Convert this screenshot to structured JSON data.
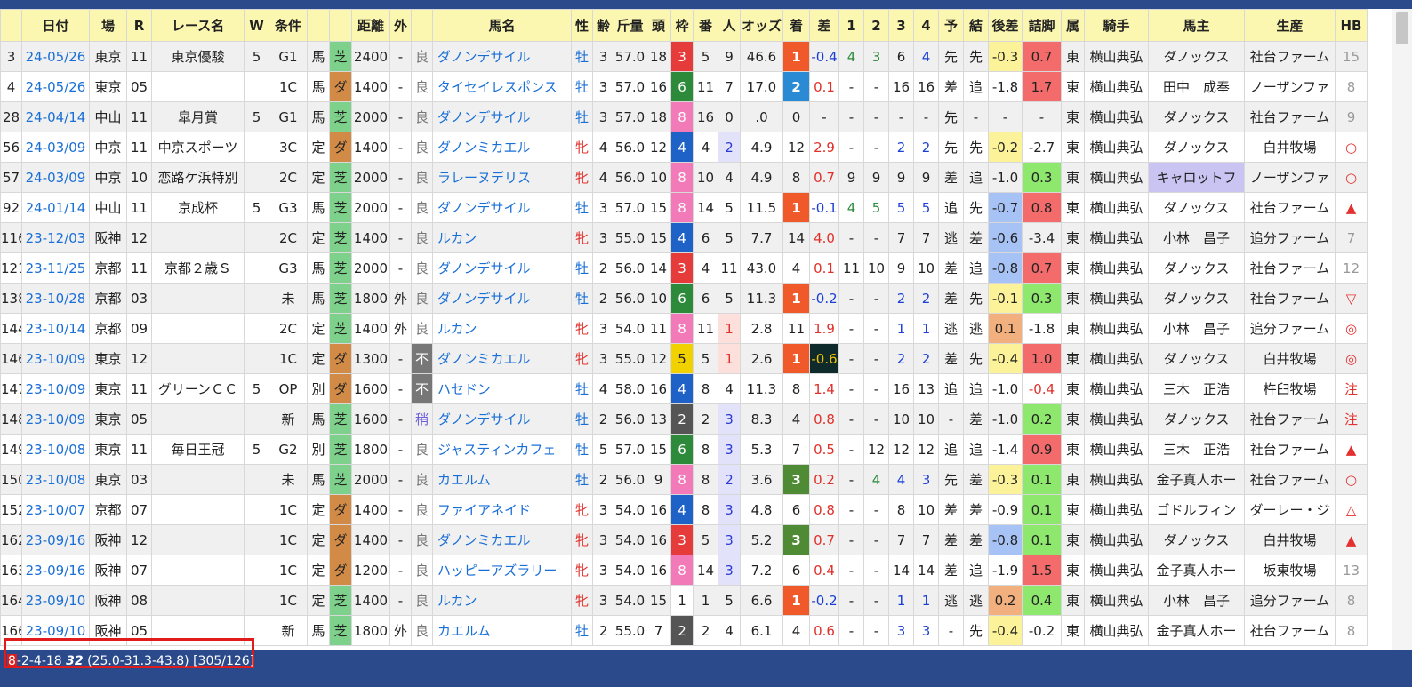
{
  "colors": {
    "accent": "#2b4a8c",
    "link": "#1a6fd6",
    "female": "#e0302a",
    "turf": "#7ed18a",
    "dirt": "#d28b46",
    "header_bg": "#fbf7b0",
    "highlight": "#e01b1b"
  },
  "headers": [
    "",
    "日付",
    "場",
    "R",
    "レース名",
    "W",
    "条件",
    "",
    "",
    "距離",
    "外",
    "",
    "馬名",
    "性",
    "齢",
    "斤量",
    "頭",
    "枠",
    "番",
    "人",
    "オッズ",
    "着",
    "差",
    "1",
    "2",
    "3",
    "4",
    "予",
    "結",
    "後差",
    "詰脚",
    "属",
    "騎手",
    "馬主",
    "生産",
    "HB"
  ],
  "rows": [
    {
      "no": "3",
      "date": "24-05/26",
      "venue": "東京",
      "r": "11",
      "race": "東京優駿",
      "w": "5",
      "grade": "G1",
      "cond": "馬",
      "surf": "芝",
      "dist": "2400",
      "out": "-",
      "track": "良",
      "horse": "ダノンデサイル",
      "sex": "牡",
      "age": "3",
      "kg": "57.0",
      "heads": "18",
      "waku": "3",
      "ban": "5",
      "pop": "9",
      "odds": "46.6",
      "chaku": "1",
      "sa": "-0.4",
      "c1": "4",
      "c2": "3",
      "c3": "6",
      "c4": "4",
      "yo": "先",
      "ke": "先",
      "atosa": "-0.3",
      "tsume": "0.7",
      "zoku": "東",
      "jockey": "横山典弘",
      "owner": "ダノックス",
      "breeder": "社台ファーム",
      "hb": "15"
    },
    {
      "no": "4",
      "date": "24-05/26",
      "venue": "東京",
      "r": "05",
      "race": "",
      "w": "",
      "grade": "1C",
      "cond": "馬",
      "surf": "ダ",
      "dist": "1400",
      "out": "-",
      "track": "良",
      "horse": "タイセイレスポンス",
      "sex": "牡",
      "age": "3",
      "kg": "57.0",
      "heads": "16",
      "waku": "6",
      "ban": "11",
      "pop": "7",
      "odds": "17.0",
      "chaku": "2",
      "sa": "0.1",
      "c1": "-",
      "c2": "-",
      "c3": "16",
      "c4": "16",
      "yo": "差",
      "ke": "追",
      "atosa": "-1.8",
      "tsume": "1.7",
      "zoku": "東",
      "jockey": "横山典弘",
      "owner": "田中　成奉",
      "breeder": "ノーザンファ",
      "hb": "8"
    },
    {
      "no": "28",
      "date": "24-04/14",
      "venue": "中山",
      "r": "11",
      "race": "皐月賞",
      "w": "5",
      "grade": "G1",
      "cond": "馬",
      "surf": "芝",
      "dist": "2000",
      "out": "-",
      "track": "良",
      "horse": "ダノンデサイル",
      "sex": "牡",
      "age": "3",
      "kg": "57.0",
      "heads": "18",
      "waku": "8",
      "ban": "16",
      "pop": "0",
      "odds": ".0",
      "chaku": "0",
      "sa": "-",
      "c1": "-",
      "c2": "-",
      "c3": "-",
      "c4": "-",
      "yo": "先",
      "ke": "-",
      "atosa": "-",
      "tsume": "-",
      "zoku": "東",
      "jockey": "横山典弘",
      "owner": "ダノックス",
      "breeder": "社台ファーム",
      "hb": "9"
    },
    {
      "no": "56",
      "date": "24-03/09",
      "venue": "中京",
      "r": "11",
      "race": "中京スポーツ",
      "w": "",
      "grade": "3C",
      "cond": "定",
      "surf": "ダ",
      "dist": "1400",
      "out": "-",
      "track": "良",
      "horse": "ダノンミカエル",
      "sex": "牝",
      "age": "4",
      "kg": "56.0",
      "heads": "12",
      "waku": "4",
      "ban": "4",
      "pop": "2",
      "odds": "4.9",
      "chaku": "12",
      "sa": "2.9",
      "c1": "-",
      "c2": "-",
      "c3": "2",
      "c4": "2",
      "yo": "先",
      "ke": "先",
      "atosa": "-0.2",
      "tsume": "-2.7",
      "zoku": "東",
      "jockey": "横山典弘",
      "owner": "ダノックス",
      "breeder": "白井牧場",
      "hb": "○"
    },
    {
      "no": "57",
      "date": "24-03/09",
      "venue": "中京",
      "r": "10",
      "race": "恋路ケ浜特別",
      "w": "",
      "grade": "2C",
      "cond": "定",
      "surf": "芝",
      "dist": "2000",
      "out": "-",
      "track": "良",
      "horse": "ラレーヌデリス",
      "sex": "牝",
      "age": "4",
      "kg": "56.0",
      "heads": "10",
      "waku": "8",
      "ban": "10",
      "pop": "4",
      "odds": "4.9",
      "chaku": "8",
      "sa": "0.7",
      "c1": "9",
      "c2": "9",
      "c3": "9",
      "c4": "9",
      "yo": "差",
      "ke": "追",
      "atosa": "-1.0",
      "tsume": "0.3",
      "zoku": "東",
      "jockey": "横山典弘",
      "owner": "キャロットフ",
      "breeder": "ノーザンファ",
      "hb": "○"
    },
    {
      "no": "92",
      "date": "24-01/14",
      "venue": "中山",
      "r": "11",
      "race": "京成杯",
      "w": "5",
      "grade": "G3",
      "cond": "馬",
      "surf": "芝",
      "dist": "2000",
      "out": "-",
      "track": "良",
      "horse": "ダノンデサイル",
      "sex": "牡",
      "age": "3",
      "kg": "57.0",
      "heads": "15",
      "waku": "8",
      "ban": "14",
      "pop": "5",
      "odds": "11.5",
      "chaku": "1",
      "sa": "-0.1",
      "c1": "4",
      "c2": "5",
      "c3": "5",
      "c4": "5",
      "yo": "追",
      "ke": "先",
      "atosa": "-0.7",
      "tsume": "0.8",
      "zoku": "東",
      "jockey": "横山典弘",
      "owner": "ダノックス",
      "breeder": "社台ファーム",
      "hb": "▲"
    },
    {
      "no": "116",
      "date": "23-12/03",
      "venue": "阪神",
      "r": "12",
      "race": "",
      "w": "",
      "grade": "2C",
      "cond": "定",
      "surf": "芝",
      "dist": "1400",
      "out": "-",
      "track": "良",
      "horse": "ルカン",
      "sex": "牝",
      "age": "3",
      "kg": "55.0",
      "heads": "15",
      "waku": "4",
      "ban": "6",
      "pop": "5",
      "odds": "7.7",
      "chaku": "14",
      "sa": "4.0",
      "c1": "-",
      "c2": "-",
      "c3": "7",
      "c4": "7",
      "yo": "逃",
      "ke": "差",
      "atosa": "-0.6",
      "tsume": "-3.4",
      "zoku": "東",
      "jockey": "横山典弘",
      "owner": "小林　昌子",
      "breeder": "追分ファーム",
      "hb": "7"
    },
    {
      "no": "121",
      "date": "23-11/25",
      "venue": "京都",
      "r": "11",
      "race": "京都２歳Ｓ",
      "w": "",
      "grade": "G3",
      "cond": "馬",
      "surf": "芝",
      "dist": "2000",
      "out": "-",
      "track": "良",
      "horse": "ダノンデサイル",
      "sex": "牡",
      "age": "2",
      "kg": "56.0",
      "heads": "14",
      "waku": "3",
      "ban": "4",
      "pop": "11",
      "odds": "43.0",
      "chaku": "4",
      "sa": "0.1",
      "c1": "11",
      "c2": "10",
      "c3": "9",
      "c4": "10",
      "yo": "差",
      "ke": "追",
      "atosa": "-0.8",
      "tsume": "0.7",
      "zoku": "東",
      "jockey": "横山典弘",
      "owner": "ダノックス",
      "breeder": "社台ファーム",
      "hb": "12"
    },
    {
      "no": "138",
      "date": "23-10/28",
      "venue": "京都",
      "r": "03",
      "race": "",
      "w": "",
      "grade": "未",
      "cond": "馬",
      "surf": "芝",
      "dist": "1800",
      "out": "外",
      "track": "良",
      "horse": "ダノンデサイル",
      "sex": "牡",
      "age": "2",
      "kg": "56.0",
      "heads": "10",
      "waku": "6",
      "ban": "6",
      "pop": "5",
      "odds": "11.3",
      "chaku": "1",
      "sa": "-0.2",
      "c1": "-",
      "c2": "-",
      "c3": "2",
      "c4": "2",
      "yo": "差",
      "ke": "先",
      "atosa": "-0.1",
      "tsume": "0.3",
      "zoku": "東",
      "jockey": "横山典弘",
      "owner": "ダノックス",
      "breeder": "社台ファーム",
      "hb": "▽"
    },
    {
      "no": "144",
      "date": "23-10/14",
      "venue": "京都",
      "r": "09",
      "race": "",
      "w": "",
      "grade": "2C",
      "cond": "定",
      "surf": "芝",
      "dist": "1400",
      "out": "外",
      "track": "良",
      "horse": "ルカン",
      "sex": "牝",
      "age": "3",
      "kg": "54.0",
      "heads": "11",
      "waku": "8",
      "ban": "11",
      "pop": "1",
      "odds": "2.8",
      "chaku": "11",
      "sa": "1.9",
      "c1": "-",
      "c2": "-",
      "c3": "1",
      "c4": "1",
      "yo": "逃",
      "ke": "逃",
      "atosa": "0.1",
      "tsume": "-1.8",
      "zoku": "東",
      "jockey": "横山典弘",
      "owner": "小林　昌子",
      "breeder": "追分ファーム",
      "hb": "◎"
    },
    {
      "no": "146",
      "date": "23-10/09",
      "venue": "東京",
      "r": "12",
      "race": "",
      "w": "",
      "grade": "1C",
      "cond": "定",
      "surf": "ダ",
      "dist": "1300",
      "out": "-",
      "track": "不",
      "horse": "ダノンミカエル",
      "sex": "牝",
      "age": "3",
      "kg": "55.0",
      "heads": "12",
      "waku": "5",
      "ban": "5",
      "pop": "1",
      "odds": "2.6",
      "chaku": "1",
      "sa": "-0.6",
      "c1": "-",
      "c2": "-",
      "c3": "2",
      "c4": "2",
      "yo": "差",
      "ke": "先",
      "atosa": "-0.4",
      "tsume": "1.0",
      "zoku": "東",
      "jockey": "横山典弘",
      "owner": "ダノックス",
      "breeder": "白井牧場",
      "hb": "◎"
    },
    {
      "no": "147",
      "date": "23-10/09",
      "venue": "東京",
      "r": "11",
      "race": "グリーンＣＣ",
      "w": "5",
      "grade": "OP",
      "cond": "別",
      "surf": "ダ",
      "dist": "1600",
      "out": "-",
      "track": "不",
      "horse": "ハセドン",
      "sex": "牡",
      "age": "4",
      "kg": "58.0",
      "heads": "16",
      "waku": "4",
      "ban": "8",
      "pop": "4",
      "odds": "11.3",
      "chaku": "8",
      "sa": "1.4",
      "c1": "-",
      "c2": "-",
      "c3": "16",
      "c4": "13",
      "yo": "追",
      "ke": "追",
      "atosa": "-1.0",
      "tsume": "-0.4",
      "zoku": "東",
      "jockey": "横山典弘",
      "owner": "三木　正浩",
      "breeder": "杵臼牧場",
      "hb": "注"
    },
    {
      "no": "148",
      "date": "23-10/09",
      "venue": "東京",
      "r": "05",
      "race": "",
      "w": "",
      "grade": "新",
      "cond": "馬",
      "surf": "芝",
      "dist": "1600",
      "out": "-",
      "track": "稍",
      "horse": "ダノンデサイル",
      "sex": "牡",
      "age": "2",
      "kg": "56.0",
      "heads": "13",
      "waku": "2",
      "ban": "2",
      "pop": "3",
      "odds": "8.3",
      "chaku": "4",
      "sa": "0.8",
      "c1": "-",
      "c2": "-",
      "c3": "10",
      "c4": "10",
      "yo": "-",
      "ke": "差",
      "atosa": "-1.0",
      "tsume": "0.2",
      "zoku": "東",
      "jockey": "横山典弘",
      "owner": "ダノックス",
      "breeder": "社台ファーム",
      "hb": "注"
    },
    {
      "no": "149",
      "date": "23-10/08",
      "venue": "東京",
      "r": "11",
      "race": "毎日王冠",
      "w": "5",
      "grade": "G2",
      "cond": "別",
      "surf": "芝",
      "dist": "1800",
      "out": "-",
      "track": "良",
      "horse": "ジャスティンカフェ",
      "sex": "牡",
      "age": "5",
      "kg": "57.0",
      "heads": "15",
      "waku": "6",
      "ban": "8",
      "pop": "3",
      "odds": "5.3",
      "chaku": "7",
      "sa": "0.5",
      "c1": "-",
      "c2": "12",
      "c3": "12",
      "c4": "12",
      "yo": "追",
      "ke": "追",
      "atosa": "-1.4",
      "tsume": "0.9",
      "zoku": "東",
      "jockey": "横山典弘",
      "owner": "三木　正浩",
      "breeder": "社台ファーム",
      "hb": "▲"
    },
    {
      "no": "150",
      "date": "23-10/08",
      "venue": "東京",
      "r": "03",
      "race": "",
      "w": "",
      "grade": "未",
      "cond": "馬",
      "surf": "芝",
      "dist": "2000",
      "out": "-",
      "track": "良",
      "horse": "カエルム",
      "sex": "牡",
      "age": "2",
      "kg": "56.0",
      "heads": "9",
      "waku": "8",
      "ban": "8",
      "pop": "2",
      "odds": "3.6",
      "chaku": "3",
      "sa": "0.2",
      "c1": "-",
      "c2": "4",
      "c3": "4",
      "c4": "3",
      "yo": "先",
      "ke": "差",
      "atosa": "-0.3",
      "tsume": "0.1",
      "zoku": "東",
      "jockey": "横山典弘",
      "owner": "金子真人ホー",
      "breeder": "社台ファーム",
      "hb": "○"
    },
    {
      "no": "152",
      "date": "23-10/07",
      "venue": "京都",
      "r": "07",
      "race": "",
      "w": "",
      "grade": "1C",
      "cond": "定",
      "surf": "ダ",
      "dist": "1400",
      "out": "-",
      "track": "良",
      "horse": "ファイアネイド",
      "sex": "牝",
      "age": "3",
      "kg": "54.0",
      "heads": "16",
      "waku": "4",
      "ban": "8",
      "pop": "3",
      "odds": "4.8",
      "chaku": "6",
      "sa": "0.8",
      "c1": "-",
      "c2": "-",
      "c3": "8",
      "c4": "10",
      "yo": "差",
      "ke": "差",
      "atosa": "-0.9",
      "tsume": "0.1",
      "zoku": "東",
      "jockey": "横山典弘",
      "owner": "ゴドルフィン",
      "breeder": "ダーレー・ジ",
      "hb": "△"
    },
    {
      "no": "162",
      "date": "23-09/16",
      "venue": "阪神",
      "r": "12",
      "race": "",
      "w": "",
      "grade": "1C",
      "cond": "定",
      "surf": "ダ",
      "dist": "1400",
      "out": "-",
      "track": "良",
      "horse": "ダノンミカエル",
      "sex": "牝",
      "age": "3",
      "kg": "54.0",
      "heads": "16",
      "waku": "3",
      "ban": "5",
      "pop": "3",
      "odds": "5.2",
      "chaku": "3",
      "sa": "0.7",
      "c1": "-",
      "c2": "-",
      "c3": "7",
      "c4": "7",
      "yo": "差",
      "ke": "差",
      "atosa": "-0.8",
      "tsume": "0.1",
      "zoku": "東",
      "jockey": "横山典弘",
      "owner": "ダノックス",
      "breeder": "白井牧場",
      "hb": "▲"
    },
    {
      "no": "163",
      "date": "23-09/16",
      "venue": "阪神",
      "r": "07",
      "race": "",
      "w": "",
      "grade": "1C",
      "cond": "定",
      "surf": "ダ",
      "dist": "1200",
      "out": "-",
      "track": "良",
      "horse": "ハッピーアズラリー",
      "sex": "牝",
      "age": "3",
      "kg": "54.0",
      "heads": "16",
      "waku": "8",
      "ban": "14",
      "pop": "3",
      "odds": "7.2",
      "chaku": "6",
      "sa": "0.4",
      "c1": "-",
      "c2": "-",
      "c3": "14",
      "c4": "14",
      "yo": "差",
      "ke": "追",
      "atosa": "-1.9",
      "tsume": "1.5",
      "zoku": "東",
      "jockey": "横山典弘",
      "owner": "金子真人ホー",
      "breeder": "坂東牧場",
      "hb": "13"
    },
    {
      "no": "164",
      "date": "23-09/10",
      "venue": "阪神",
      "r": "08",
      "race": "",
      "w": "",
      "grade": "1C",
      "cond": "定",
      "surf": "芝",
      "dist": "1400",
      "out": "-",
      "track": "良",
      "horse": "ルカン",
      "sex": "牝",
      "age": "3",
      "kg": "54.0",
      "heads": "15",
      "waku": "1",
      "ban": "1",
      "pop": "5",
      "odds": "6.6",
      "chaku": "1",
      "sa": "-0.2",
      "c1": "-",
      "c2": "-",
      "c3": "1",
      "c4": "1",
      "yo": "逃",
      "ke": "逃",
      "atosa": "0.2",
      "tsume": "0.4",
      "zoku": "東",
      "jockey": "横山典弘",
      "owner": "小林　昌子",
      "breeder": "追分ファーム",
      "hb": "8"
    },
    {
      "no": "166",
      "date": "23-09/10",
      "venue": "阪神",
      "r": "05",
      "race": "",
      "w": "",
      "grade": "新",
      "cond": "馬",
      "surf": "芝",
      "dist": "1800",
      "out": "外",
      "track": "良",
      "horse": "カエルム",
      "sex": "牡",
      "age": "2",
      "kg": "55.0",
      "heads": "7",
      "waku": "2",
      "ban": "2",
      "pop": "4",
      "odds": "6.1",
      "chaku": "4",
      "sa": "0.6",
      "c1": "-",
      "c2": "-",
      "c3": "3",
      "c4": "3",
      "yo": "-",
      "ke": "先",
      "atosa": "-0.4",
      "tsume": "-0.2",
      "zoku": "東",
      "jockey": "横山典弘",
      "owner": "金子真人ホー",
      "breeder": "社台ファーム",
      "hb": "8"
    }
  ],
  "summary": {
    "first": "8",
    "rest": "-2-4-18 ",
    "bold": "32",
    "tail": " (25.0-31.3-43.8) [305/126]"
  }
}
